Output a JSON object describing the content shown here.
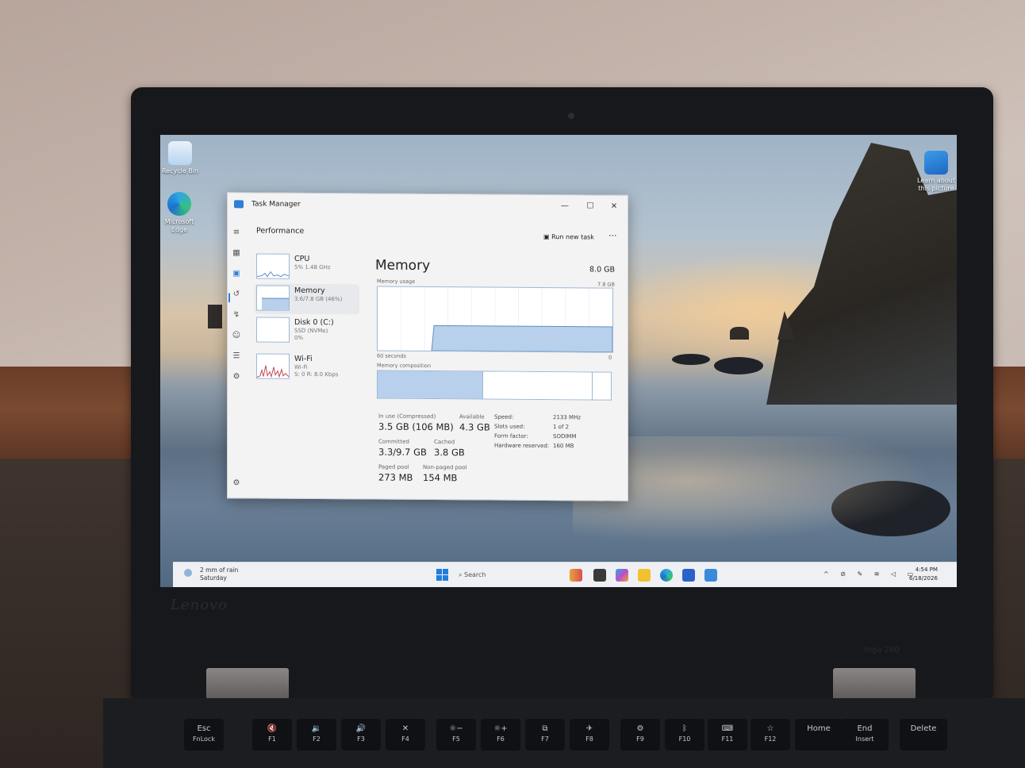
{
  "desktop": {
    "icons": [
      {
        "label": "Recycle Bin"
      },
      {
        "label": "Microsoft Edge"
      }
    ],
    "spotlight": {
      "label": "Learn about this picture"
    }
  },
  "task_manager": {
    "title": "Task Manager",
    "page_header": "Performance",
    "run_new_task": "Run new task",
    "more": "···",
    "window_controls": {
      "minimize": "—",
      "maximize": "☐",
      "close": "✕"
    },
    "sidebar": [
      {
        "name": "CPU",
        "sub": "5% 1.48 GHz"
      },
      {
        "name": "Memory",
        "sub": "3.6/7.8 GB (46%)"
      },
      {
        "name": "Disk 0 (C:)",
        "sub": "SSD (NVMe)",
        "sub2": "0%"
      },
      {
        "name": "Wi-Fi",
        "sub": "Wi-Fi",
        "sub2": "S: 0 R: 8.0 Kbps"
      }
    ],
    "memory": {
      "title": "Memory",
      "total": "8.0 GB",
      "usage_label": "Memory usage",
      "usage_max": "7.8 GB",
      "time_label": "60 seconds",
      "time_end": "0",
      "composition_label": "Memory composition",
      "usage_fraction": 0.46,
      "composition": {
        "in_use": 0.45,
        "modified": 0.0,
        "standby": 0.47,
        "free": 0.07
      },
      "stats": [
        {
          "label": "In use (Compressed)",
          "value": "3.5 GB (106 MB)"
        },
        {
          "label": "Available",
          "value": "4.3 GB"
        },
        {
          "label": "Committed",
          "value": "3.3/9.7 GB"
        },
        {
          "label": "Cached",
          "value": "3.8 GB"
        },
        {
          "label": "Paged pool",
          "value": "273 MB"
        },
        {
          "label": "Non-paged pool",
          "value": "154 MB"
        }
      ],
      "specs": [
        {
          "label": "Speed:",
          "value": "2133 MHz"
        },
        {
          "label": "Slots used:",
          "value": "1 of 2"
        },
        {
          "label": "Form factor:",
          "value": "SODIMM"
        },
        {
          "label": "Hardware reserved:",
          "value": "160 MB"
        }
      ]
    }
  },
  "taskbar": {
    "weather_line1": "2 mm of rain",
    "weather_line2": "Saturday",
    "search_placeholder": "Search",
    "time": "4:54 PM",
    "date": "6/18/2026"
  },
  "keyboard": {
    "keys": [
      {
        "top": "Esc",
        "bottom": "FnLock"
      },
      {
        "top": "🔇",
        "bottom": "F1"
      },
      {
        "top": "🔉",
        "bottom": "F2"
      },
      {
        "top": "🔊",
        "bottom": "F3"
      },
      {
        "top": "✕",
        "bottom": "F4"
      },
      {
        "top": "☼−",
        "bottom": "F5"
      },
      {
        "top": "☼+",
        "bottom": "F6"
      },
      {
        "top": "⧉",
        "bottom": "F7"
      },
      {
        "top": "✈",
        "bottom": "F8"
      },
      {
        "top": "⚙",
        "bottom": "F9"
      },
      {
        "top": "ᛒ",
        "bottom": "F10"
      },
      {
        "top": "⌨",
        "bottom": "F11"
      },
      {
        "top": "☆",
        "bottom": "F12"
      },
      {
        "top": "Home",
        "bottom": ""
      },
      {
        "top": "End",
        "bottom": "Insert"
      },
      {
        "top": "Delete",
        "bottom": ""
      }
    ]
  },
  "colors": {
    "accent": "#1f7de0",
    "graph_fill": "#b8d0ec",
    "graph_line": "#5e8fc7"
  }
}
